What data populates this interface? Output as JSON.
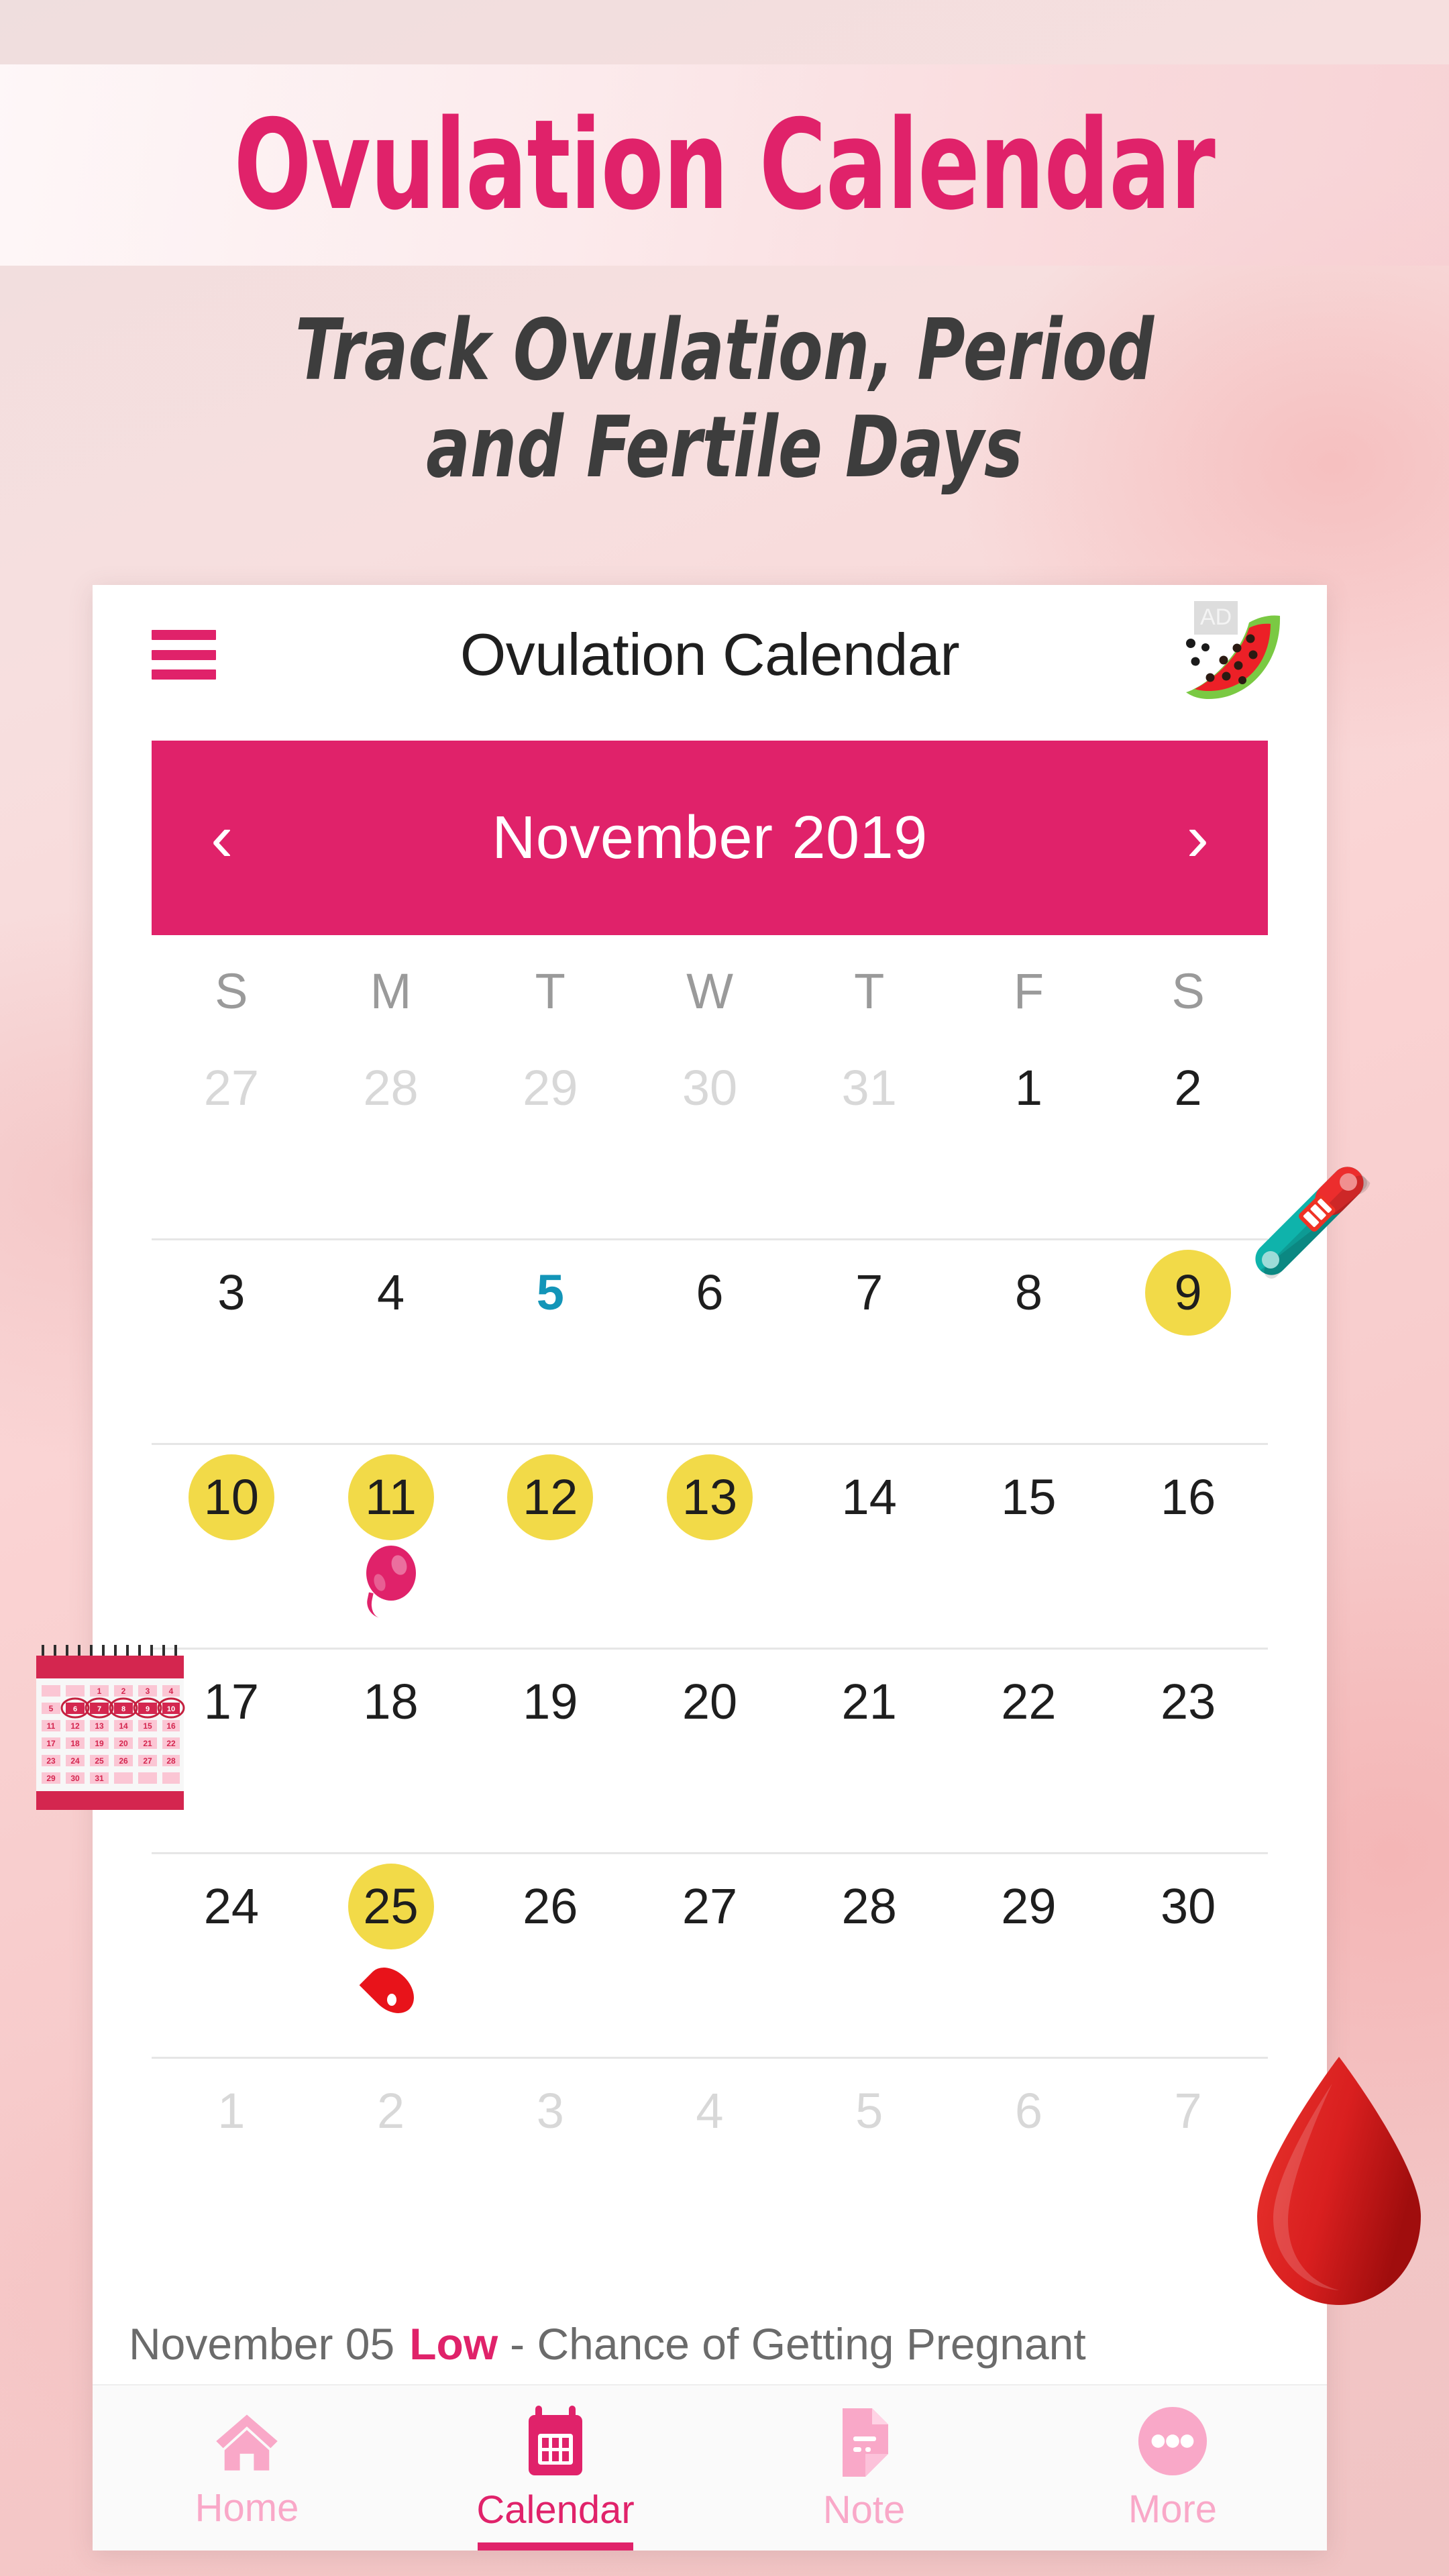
{
  "promo": {
    "title": "Ovulation Calendar",
    "subtitle_line1": "Track Ovulation, Period",
    "subtitle_line2": "and Fertile Days"
  },
  "colors": {
    "brand_pink": "#e0226a",
    "fertile_yellow": "#f2da48",
    "today_blue": "#1395b8",
    "muted_gray": "#d8d8d8",
    "blood_red": "#e8131a",
    "nav_inactive": "#f9a8c8"
  },
  "app": {
    "title": "Ovulation Calendar",
    "menu_icon": "hamburger-icon",
    "ad_badge": "AD",
    "ad_icon": "watermelon-icon"
  },
  "month_bar": {
    "prev_icon": "chevron-left-icon",
    "next_icon": "chevron-right-icon",
    "month": "November",
    "year": "2019"
  },
  "calendar": {
    "weekdays": [
      "S",
      "M",
      "T",
      "W",
      "T",
      "F",
      "S"
    ],
    "rows": [
      [
        {
          "n": "27",
          "state": "muted"
        },
        {
          "n": "28",
          "state": "muted"
        },
        {
          "n": "29",
          "state": "muted"
        },
        {
          "n": "30",
          "state": "muted"
        },
        {
          "n": "31",
          "state": "muted"
        },
        {
          "n": "1",
          "state": "normal"
        },
        {
          "n": "2",
          "state": "normal"
        }
      ],
      [
        {
          "n": "3",
          "state": "normal"
        },
        {
          "n": "4",
          "state": "normal"
        },
        {
          "n": "5",
          "state": "today"
        },
        {
          "n": "6",
          "state": "normal"
        },
        {
          "n": "7",
          "state": "normal"
        },
        {
          "n": "8",
          "state": "normal"
        },
        {
          "n": "9",
          "state": "fertile"
        }
      ],
      [
        {
          "n": "10",
          "state": "fertile"
        },
        {
          "n": "11",
          "state": "fertile",
          "marker": "ovulation-egg-icon"
        },
        {
          "n": "12",
          "state": "fertile"
        },
        {
          "n": "13",
          "state": "fertile"
        },
        {
          "n": "14",
          "state": "normal"
        },
        {
          "n": "15",
          "state": "normal"
        },
        {
          "n": "16",
          "state": "normal"
        }
      ],
      [
        {
          "n": "17",
          "state": "normal"
        },
        {
          "n": "18",
          "state": "normal"
        },
        {
          "n": "19",
          "state": "normal"
        },
        {
          "n": "20",
          "state": "normal"
        },
        {
          "n": "21",
          "state": "normal"
        },
        {
          "n": "22",
          "state": "normal"
        },
        {
          "n": "23",
          "state": "normal"
        }
      ],
      [
        {
          "n": "24",
          "state": "normal"
        },
        {
          "n": "25",
          "state": "fertile",
          "marker": "period-drop-icon"
        },
        {
          "n": "26",
          "state": "normal"
        },
        {
          "n": "27",
          "state": "normal"
        },
        {
          "n": "28",
          "state": "normal"
        },
        {
          "n": "29",
          "state": "normal"
        },
        {
          "n": "30",
          "state": "normal"
        }
      ],
      [
        {
          "n": "1",
          "state": "muted"
        },
        {
          "n": "2",
          "state": "muted"
        },
        {
          "n": "3",
          "state": "muted"
        },
        {
          "n": "4",
          "state": "muted"
        },
        {
          "n": "5",
          "state": "muted"
        },
        {
          "n": "6",
          "state": "muted"
        },
        {
          "n": "7",
          "state": "muted"
        }
      ]
    ]
  },
  "status": {
    "date": "November 05",
    "level": "Low",
    "description": "- Chance of Getting Pregnant"
  },
  "bottom_nav": {
    "items": [
      {
        "label": "Home",
        "icon": "home-icon",
        "active": false
      },
      {
        "label": "Calendar",
        "icon": "calendar-icon",
        "active": true
      },
      {
        "label": "Note",
        "icon": "note-icon",
        "active": false
      },
      {
        "label": "More",
        "icon": "more-dots-icon",
        "active": false
      }
    ]
  },
  "decorations": [
    {
      "name": "thermometer-icon"
    },
    {
      "name": "blood-drop-icon"
    },
    {
      "name": "wall-calendar-icon"
    }
  ]
}
